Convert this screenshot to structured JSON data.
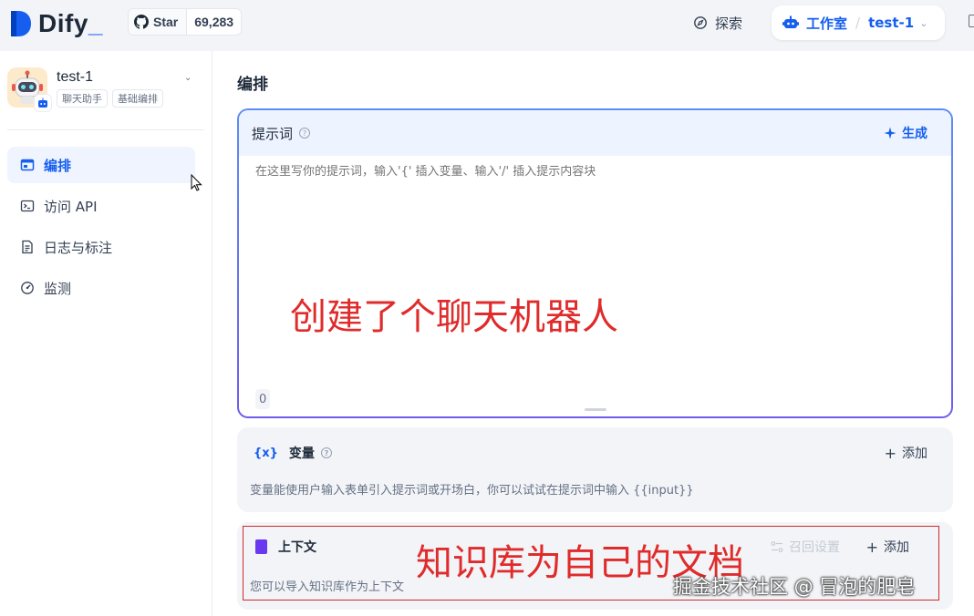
{
  "header": {
    "logo_text": "Dify",
    "github": {
      "star_label": "Star",
      "star_count": "69,283"
    },
    "explore_label": "探索",
    "workspace_label": "工作室",
    "workspace_sep": "/",
    "current_app": "test-1"
  },
  "sidebar": {
    "app": {
      "name": "test-1",
      "tags": [
        "聊天助手",
        "基础编排"
      ]
    },
    "items": [
      {
        "label": "编排",
        "icon": "layout-icon",
        "active": true
      },
      {
        "label": "访问 API",
        "icon": "terminal-icon",
        "active": false
      },
      {
        "label": "日志与标注",
        "icon": "file-list-icon",
        "active": false
      },
      {
        "label": "监测",
        "icon": "gauge-icon",
        "active": false
      }
    ]
  },
  "main": {
    "title": "编排",
    "prompt": {
      "title": "提示词",
      "generate_label": "生成",
      "placeholder": "在这里写你的提示词，输入'{' 插入变量、输入'/' 插入提示内容块",
      "char_count": "0"
    },
    "variables": {
      "title": "变量",
      "icon_text": "{x}",
      "add_label": "添加",
      "description": "变量能使用户输入表单引入提示词或开场白，你可以试试在提示词中输入 {{input}}"
    },
    "context": {
      "title": "上下文",
      "recall_label": "召回设置",
      "add_label": "添加",
      "description": "您可以导入知识库作为上下文"
    }
  },
  "annotations": {
    "prompt_note": "创建了个聊天机器人",
    "context_note": "知识库为自己的文档"
  },
  "watermark": "掘金技术社区 @ 冒泡的肥皂",
  "colors": {
    "accent": "#155eef",
    "annotation": "#e02b2b",
    "context_icon": "#6938ef"
  }
}
